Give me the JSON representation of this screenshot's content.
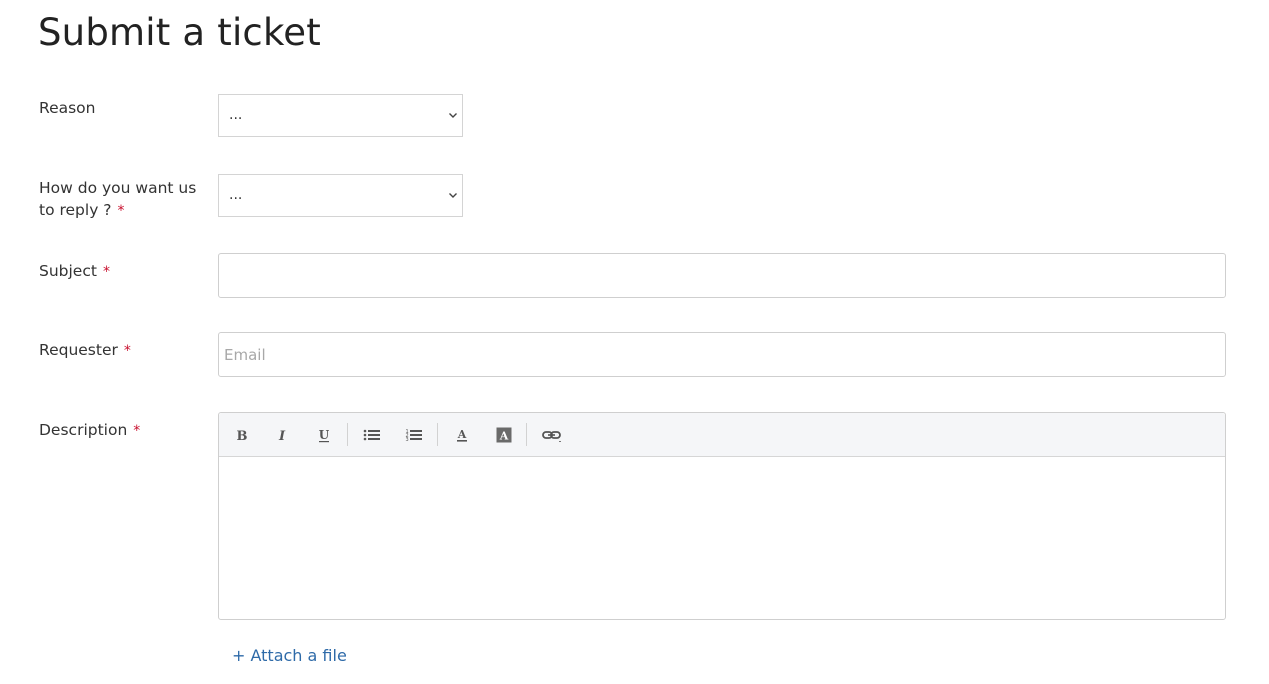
{
  "page": {
    "title": "Submit a ticket"
  },
  "form": {
    "reason": {
      "label": "Reason",
      "value": "..."
    },
    "reply": {
      "label": "How do you want us to reply ?",
      "required_mark": "*",
      "value": "..."
    },
    "subject": {
      "label": "Subject",
      "required_mark": "*",
      "value": ""
    },
    "requester": {
      "label": "Requester",
      "required_mark": "*",
      "placeholder": "Email",
      "value": ""
    },
    "description": {
      "label": "Description",
      "required_mark": "*",
      "toolbar": {
        "bold": {
          "icon": "bold-icon"
        },
        "italic": {
          "icon": "italic-icon"
        },
        "underline": {
          "icon": "underline-icon"
        },
        "bullet_list": {
          "icon": "bulleted-list-icon"
        },
        "numbered_list": {
          "icon": "numbered-list-icon"
        },
        "text_color": {
          "icon": "text-color-icon"
        },
        "background_color": {
          "icon": "background-color-icon"
        },
        "link": {
          "icon": "link-icon"
        }
      }
    },
    "attach_label": "+ Attach a file"
  },
  "colors": {
    "required": "#c8102e",
    "link": "#2e6aa8",
    "toolbar_bg": "#f5f6f8",
    "border": "#cfcfcf"
  }
}
